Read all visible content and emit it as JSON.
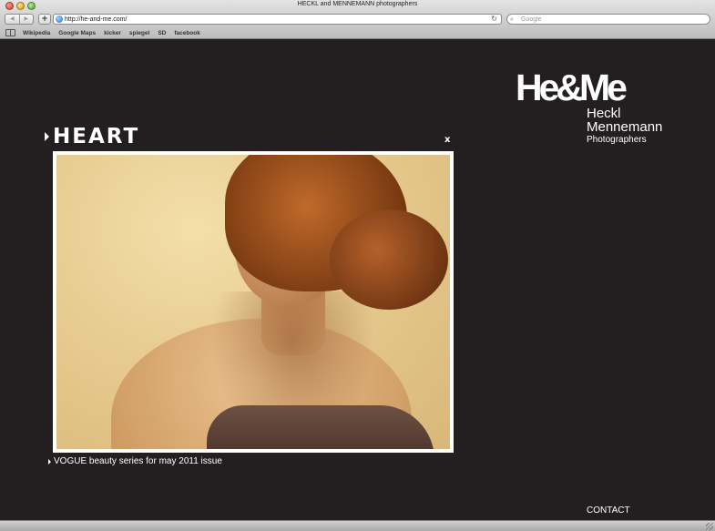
{
  "window": {
    "title": "HECKL and MENNEMANN photographers"
  },
  "toolbar": {
    "back_glyph": "◀",
    "forward_glyph": "▶",
    "add_glyph": "+",
    "url": "http://he-and-me.com/",
    "reload_glyph": "↻",
    "search_glyph": "⌕",
    "search_placeholder": "Google"
  },
  "bookmarks": [
    "Wikipedia",
    "Google Maps",
    "kicker",
    "spiegel",
    "SD",
    "facebook"
  ],
  "logo": {
    "mark": "He&Me",
    "line1": "Heckl",
    "line2": "Mennemann",
    "line3": "Photographers"
  },
  "section": {
    "title": "HEART",
    "close_label": "x",
    "caption": "VOGUE beauty series for may 2011 issue"
  },
  "footer": {
    "contact_label": "CONTACT"
  },
  "colors": {
    "page_bg": "#231f20",
    "text": "#ffffff",
    "frame": "#ffffff"
  }
}
